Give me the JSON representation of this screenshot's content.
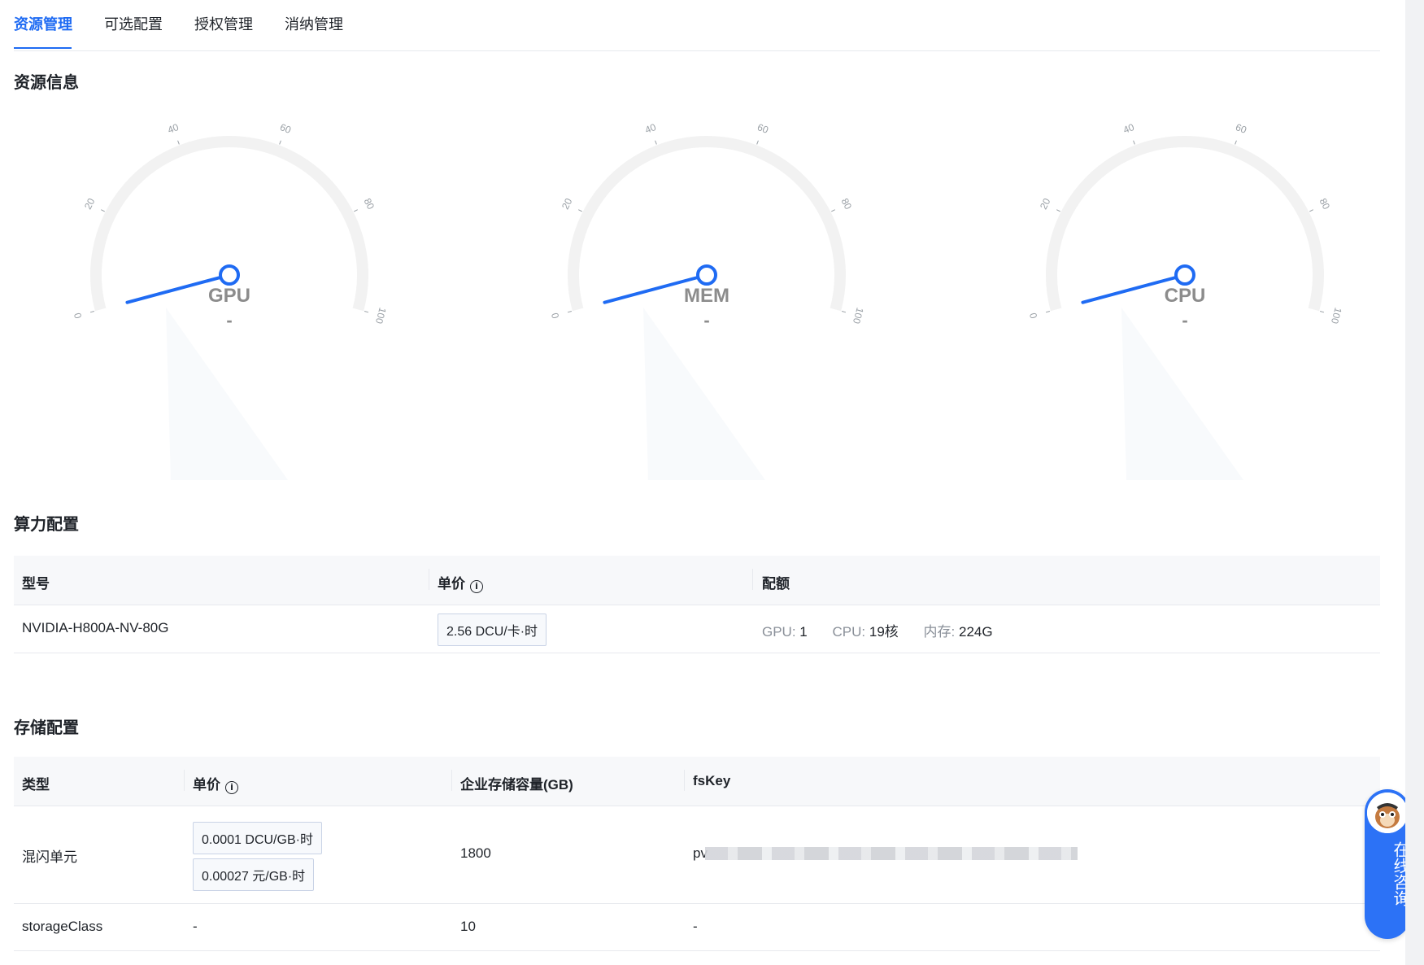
{
  "tabs": [
    {
      "label": "资源管理",
      "active": true
    },
    {
      "label": "可选配置",
      "active": false
    },
    {
      "label": "授权管理",
      "active": false
    },
    {
      "label": "消纳管理",
      "active": false
    }
  ],
  "resource_info": {
    "title": "资源信息",
    "gauges": [
      {
        "label": "GPU",
        "value_text": "-",
        "needle_value": 0
      },
      {
        "label": "MEM",
        "value_text": "-",
        "needle_value": 0
      },
      {
        "label": "CPU",
        "value_text": "-",
        "needle_value": 0
      }
    ],
    "ticks": [
      "0",
      "20",
      "40",
      "60",
      "80",
      "100"
    ],
    "accent_color": "#1f6bf3",
    "track_color": "#f2f2f2"
  },
  "compute": {
    "title": "算力配置",
    "headers": {
      "model": "型号",
      "price": "单价",
      "quota": "配额"
    },
    "rows": [
      {
        "model": "NVIDIA-H800A-NV-80G",
        "price": "2.56 DCU/卡·时",
        "quota": [
          {
            "key": "GPU:",
            "value": "1"
          },
          {
            "key": "CPU:",
            "value": "19核"
          },
          {
            "key": "内存:",
            "value": "224G"
          }
        ]
      }
    ]
  },
  "storage": {
    "title": "存储配置",
    "headers": {
      "type": "类型",
      "price": "单价",
      "capacity": "企业存储容量(GB)",
      "fskey": "fsKey"
    },
    "rows": [
      {
        "type": "混闪单元",
        "prices": [
          "0.0001 DCU/GB·时",
          "0.00027 元/GB·时"
        ],
        "capacity": "1800",
        "fskey": "pv"
      },
      {
        "type": "storageClass",
        "price": "-",
        "capacity": "10",
        "fskey": "-"
      }
    ]
  },
  "consult": {
    "label": "在线咨询"
  }
}
